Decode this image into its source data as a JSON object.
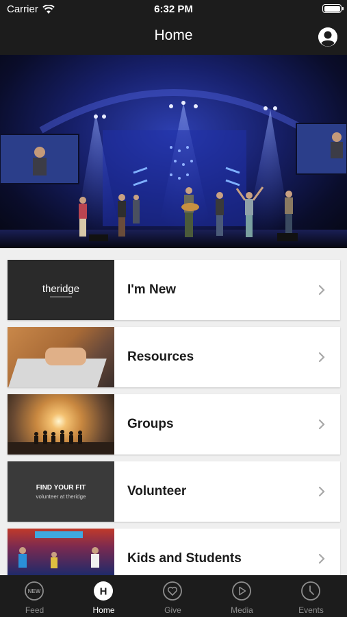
{
  "status_bar": {
    "carrier": "Carrier",
    "time": "6:32 PM"
  },
  "navbar": {
    "title": "Home"
  },
  "menu_items": [
    {
      "label": "I'm New",
      "thumb_text": "theridge"
    },
    {
      "label": "Resources"
    },
    {
      "label": "Groups"
    },
    {
      "label": "Volunteer",
      "thumb_line1": "FIND YOUR FIT",
      "thumb_line2": "volunteer at theridge"
    },
    {
      "label": "Kids and Students"
    }
  ],
  "tabs": [
    {
      "label": "Feed",
      "icon_text": "NEW"
    },
    {
      "label": "Home",
      "icon_text": "H"
    },
    {
      "label": "Give"
    },
    {
      "label": "Media"
    },
    {
      "label": "Events"
    }
  ],
  "colors": {
    "bar_background": "#1c1c1c",
    "page_background": "#efefef",
    "inactive_tab": "#8e8e8e"
  }
}
